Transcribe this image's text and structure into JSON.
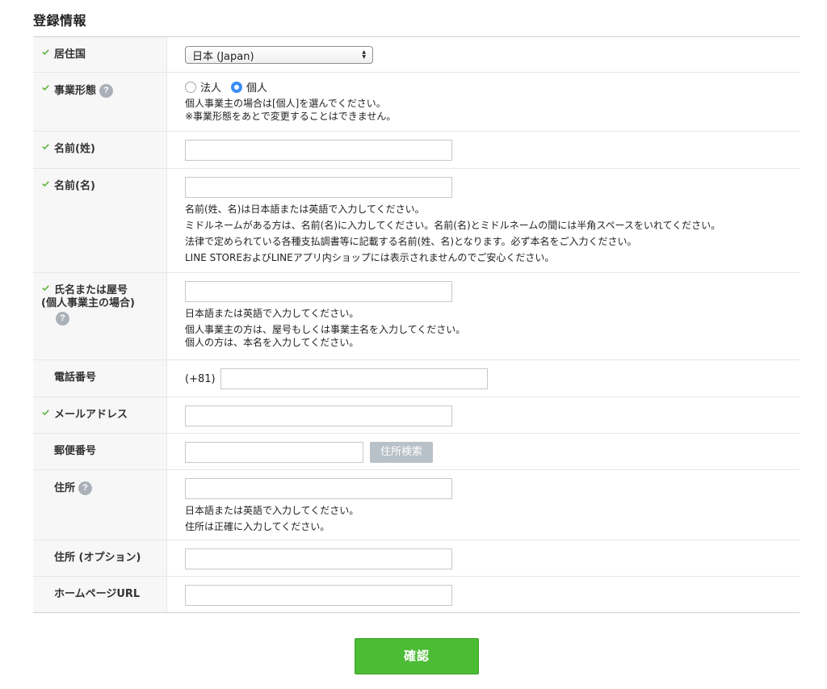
{
  "section": {
    "title": "登録情報"
  },
  "fields": {
    "country": {
      "label": "居住国",
      "value": "日本 (Japan)"
    },
    "business_type": {
      "label": "事業形態",
      "options": [
        "法人",
        "個人"
      ],
      "selected": "個人",
      "help": [
        "個人事業主の場合は[個人]を選んでください。",
        "※事業形態をあとで変更することはできません。"
      ]
    },
    "last_name": {
      "label": "名前(姓)"
    },
    "first_name": {
      "label": "名前(名)",
      "help": [
        "名前(姓、名)は日本語または英語で入力してください。",
        "ミドルネームがある方は、名前(名)に入力してください。名前(名)とミドルネームの間には半角スペースをいれてください。",
        "法律で定められている各種支払調書等に記載する名前(姓、名)となります。必ず本名をご入力ください。",
        "LINE STOREおよびLINEアプリ内ショップには表示されませんのでご安心ください。"
      ]
    },
    "trade_name": {
      "label_line1": "氏名または屋号",
      "label_line2": "(個人事業主の場合)",
      "help": [
        "日本語または英語で入力してください。",
        "個人事業主の方は、屋号もしくは事業主名を入力してください。",
        "個人の方は、本名を入力してください。"
      ]
    },
    "phone": {
      "label": "電話番号",
      "prefix": "(+81)"
    },
    "email": {
      "label": "メールアドレス"
    },
    "postal": {
      "label": "郵便番号",
      "button": "住所検索"
    },
    "address": {
      "label": "住所",
      "help": [
        "日本語または英語で入力してください。",
        "住所は正確に入力してください。"
      ]
    },
    "address_optional": {
      "label": "住所 (オプション)"
    },
    "homepage": {
      "label": "ホームページURL"
    }
  },
  "help_icon_glyph": "?",
  "confirm_button": "確認",
  "colors": {
    "check": "#5ab33e",
    "confirm": "#4cbc35",
    "radio": "#3b8df5",
    "search_button": "#b8c0c8"
  }
}
